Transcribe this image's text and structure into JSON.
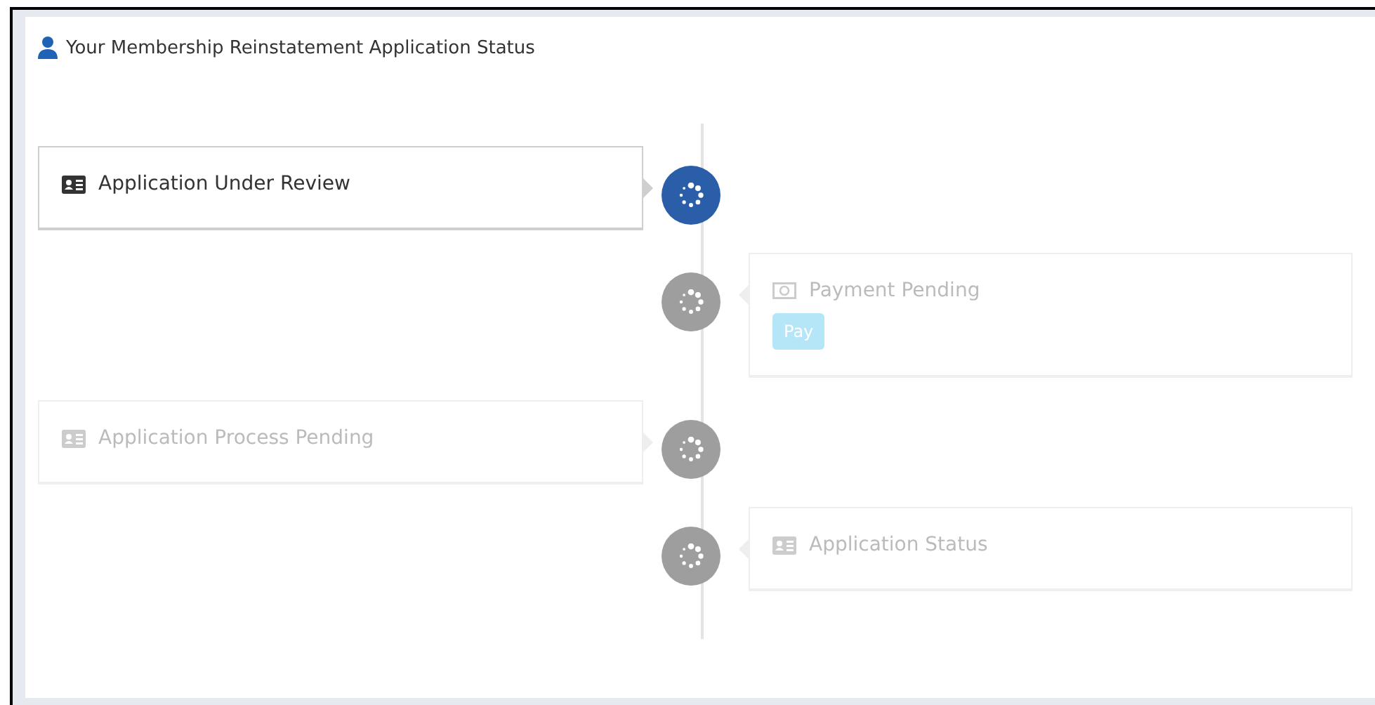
{
  "header": {
    "title": "Your Membership Reinstatement Application Status"
  },
  "timeline": [
    {
      "kind": "id-card",
      "label": "Application Under Review",
      "active": true
    },
    {
      "kind": "money",
      "label": "Payment Pending",
      "active": false,
      "button": {
        "label": "Pay",
        "disabled": true
      }
    },
    {
      "kind": "id-card",
      "label": "Application Process Pending",
      "active": false
    },
    {
      "kind": "id-card",
      "label": "Application Status",
      "active": false
    }
  ]
}
